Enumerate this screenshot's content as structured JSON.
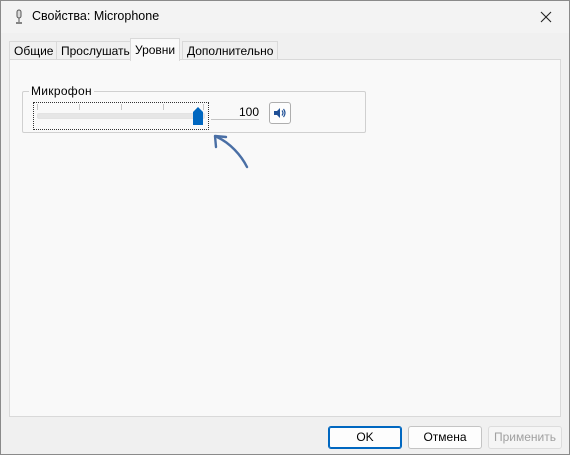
{
  "window": {
    "title": "Свойства: Microphone"
  },
  "tabs": [
    {
      "label": "Общие"
    },
    {
      "label": "Прослушать"
    },
    {
      "label": "Уровни",
      "active": true
    },
    {
      "label": "Дополнительно"
    }
  ],
  "levels": {
    "group_label": "Микрофон",
    "slider_value": 100,
    "value_text": "100",
    "mute_icon": "speaker-icon"
  },
  "buttons": {
    "ok": "OK",
    "cancel": "Отмена",
    "apply": "Применить",
    "apply_enabled": false
  },
  "colors": {
    "accent": "#0067c0",
    "annotation_arrow": "#4a6fa5"
  }
}
